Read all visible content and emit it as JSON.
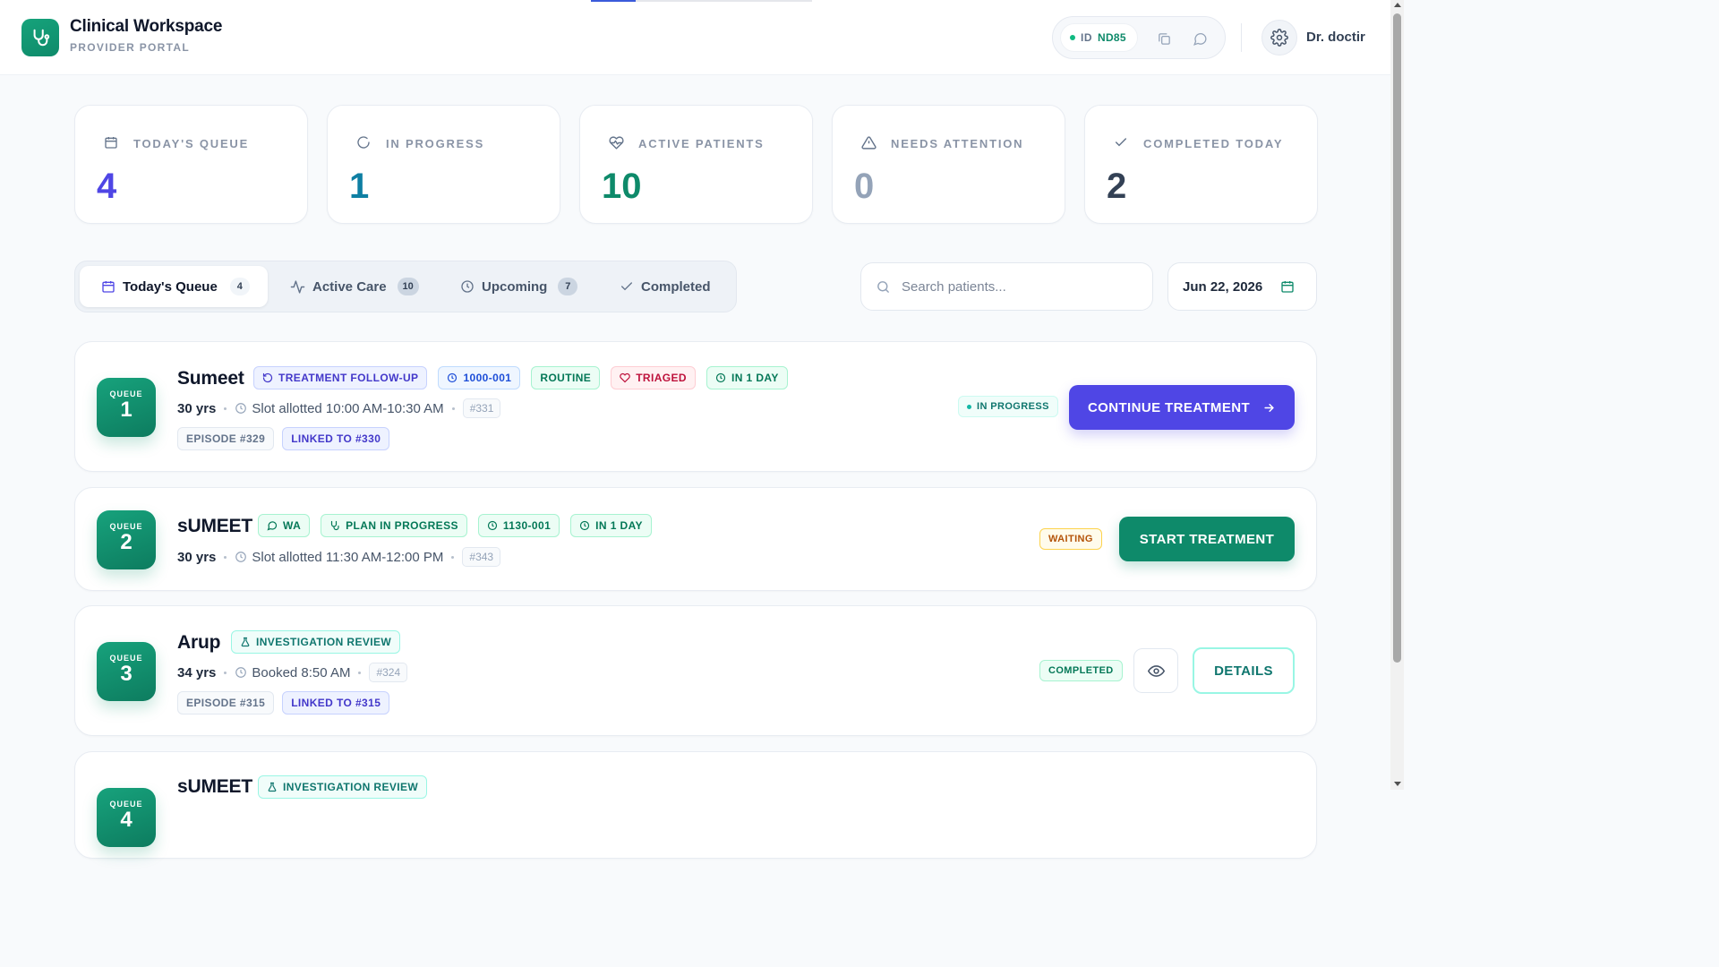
{
  "header": {
    "title": "Clinical Workspace",
    "subtitle": "PROVIDER PORTAL",
    "id_label": "ID",
    "id_value": "ND85",
    "user_name": "Dr. doctir"
  },
  "stats": [
    {
      "label": "TODAY'S QUEUE",
      "value": "4",
      "icon": "calendar-icon",
      "color": "#4f46e5"
    },
    {
      "label": "IN PROGRESS",
      "value": "1",
      "icon": "refresh-icon",
      "color": "#0e7fa3"
    },
    {
      "label": "ACTIVE PATIENTS",
      "value": "10",
      "icon": "heart-pulse-icon",
      "color": "#0e8a6a"
    },
    {
      "label": "NEEDS ATTENTION",
      "value": "0",
      "icon": "alert-triangle-icon",
      "color": "#94a3b8"
    },
    {
      "label": "COMPLETED TODAY",
      "value": "2",
      "icon": "check-icon",
      "color": "#334155"
    }
  ],
  "tabs": [
    {
      "label": "Today's Queue",
      "count": "4",
      "active": true
    },
    {
      "label": "Active Care",
      "count": "10"
    },
    {
      "label": "Upcoming",
      "count": "7"
    },
    {
      "label": "Completed",
      "count": ""
    }
  ],
  "search": {
    "placeholder": "Search patients..."
  },
  "date": "Jun 22, 2026",
  "patients": [
    {
      "queue_label": "QUEUE",
      "queue_number": "1",
      "name": "Sumeet",
      "chips": [
        "TREATMENT FOLLOW-UP",
        "1000-001",
        "ROUTINE",
        "TRIAGED",
        "IN 1 DAY"
      ],
      "age": "30 yrs",
      "slot": "Slot allotted 10:00 AM-10:30 AM",
      "ref": "#331",
      "tags": [
        "EPISODE #329",
        "LINKED TO #330"
      ],
      "status": "IN PROGRESS",
      "action": "CONTINUE TREATMENT"
    },
    {
      "queue_label": "QUEUE",
      "queue_number": "2",
      "name": "sUMEET",
      "chips": [
        "WA",
        "PLAN IN PROGRESS",
        "1130-001",
        "IN 1 DAY"
      ],
      "age": "30 yrs",
      "slot": "Slot allotted 11:30 AM-12:00 PM",
      "ref": "#343",
      "tags": [],
      "status": "WAITING",
      "action": "START TREATMENT"
    },
    {
      "queue_label": "QUEUE",
      "queue_number": "3",
      "name": "Arup",
      "chips": [
        "INVESTIGATION REVIEW"
      ],
      "age": "34 yrs",
      "slot": "Booked 8:50 AM",
      "ref": "#324",
      "tags": [
        "EPISODE #315",
        "LINKED TO #315"
      ],
      "status": "COMPLETED",
      "action": "DETAILS"
    },
    {
      "queue_label": "QUEUE",
      "queue_number": "4",
      "name": "sUMEET",
      "chips": [
        "INVESTIGATION REVIEW"
      ]
    }
  ],
  "colors": {
    "brand": "#0e8a6a",
    "primary": "#4f46e5"
  }
}
